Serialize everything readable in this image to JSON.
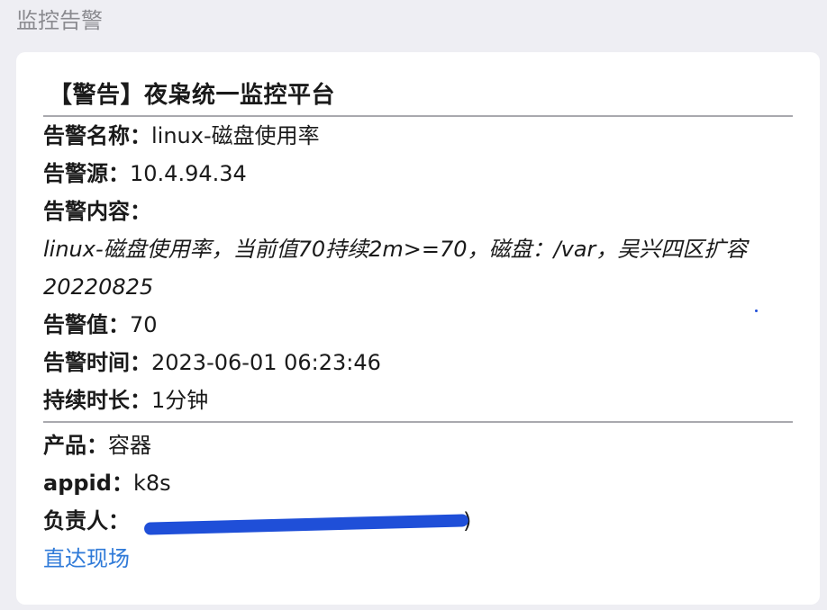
{
  "page_header": "监控告警",
  "card": {
    "title": "【警告】夜枭统一监控平台",
    "alert_name_label": "告警名称：",
    "alert_name_value": "linux-磁盘使用率",
    "alert_source_label": "告警源：",
    "alert_source_value": "10.4.94.34",
    "alert_content_label": "告警内容：",
    "alert_content_value": "linux-磁盘使用率，当前值70持续2m>=70，磁盘：/var，吴兴四区扩容20220825",
    "alert_value_label": "告警值：",
    "alert_value_value": "70",
    "alert_time_label": "告警时间：",
    "alert_time_value": "2023-06-01 06:23:46",
    "duration_label": "持续时长：",
    "duration_value": "1分钟",
    "product_label": "产品：",
    "product_value": "容器",
    "appid_label": "appid：",
    "appid_value": "k8s",
    "owner_label": "负责人：",
    "owner_value_suffix": ")",
    "link_label": "直达现场"
  },
  "colors": {
    "link": "#2f7ad8",
    "redaction": "#1f4fd8",
    "divider": "#a9a9ae"
  }
}
